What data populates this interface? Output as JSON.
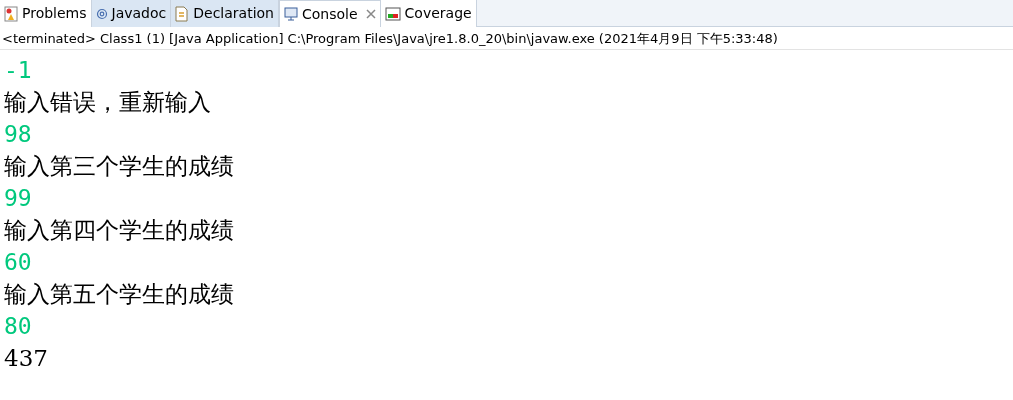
{
  "tabs": [
    {
      "label": "Problems",
      "selected": false,
      "highlighted": false,
      "closable": false
    },
    {
      "label": "Javadoc",
      "selected": false,
      "highlighted": true,
      "closable": false
    },
    {
      "label": "Declaration",
      "selected": false,
      "highlighted": true,
      "closable": false
    },
    {
      "label": "Console",
      "selected": true,
      "highlighted": false,
      "closable": true
    },
    {
      "label": "Coverage",
      "selected": false,
      "highlighted": false,
      "closable": false
    }
  ],
  "console": {
    "status": "<terminated> Class1 (1) [Java Application] C:\\Program Files\\Java\\jre1.8.0_20\\bin\\javaw.exe (2021年4月9日 下午5:33:48)",
    "lines": [
      {
        "kind": "input",
        "text": "-1"
      },
      {
        "kind": "output",
        "text": "输入错误，重新输入"
      },
      {
        "kind": "input",
        "text": "98"
      },
      {
        "kind": "output",
        "text": "输入第三个学生的成绩"
      },
      {
        "kind": "input",
        "text": "99"
      },
      {
        "kind": "output",
        "text": "输入第四个学生的成绩"
      },
      {
        "kind": "input",
        "text": "60"
      },
      {
        "kind": "output",
        "text": "输入第五个学生的成绩"
      },
      {
        "kind": "input",
        "text": "80"
      },
      {
        "kind": "output",
        "text": "437"
      }
    ]
  }
}
